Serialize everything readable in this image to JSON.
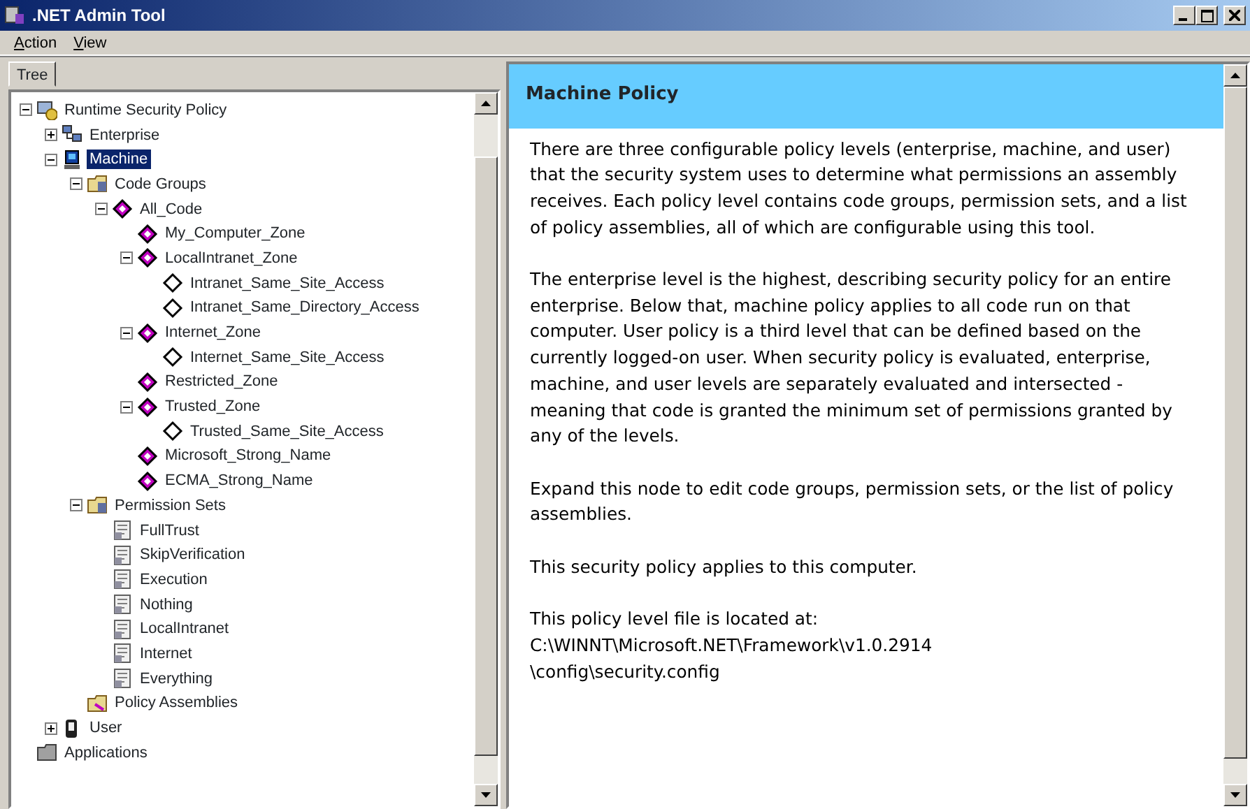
{
  "window": {
    "title": ".NET Admin Tool"
  },
  "menu": [
    "Action",
    "View"
  ],
  "tabs": [
    {
      "label": "Tree",
      "selected": true
    }
  ],
  "tree": [
    {
      "label": "Runtime Security Policy",
      "kind": "policy",
      "expanded": true,
      "selected": false,
      "children": [
        {
          "label": "Enterprise",
          "kind": "enterprise",
          "expanded": false,
          "selected": false
        },
        {
          "label": "Machine",
          "kind": "machine",
          "expanded": true,
          "selected": true,
          "children": [
            {
              "label": "Code Groups",
              "kind": "folder",
              "expanded": true,
              "selected": false,
              "children": [
                {
                  "label": "All_Code",
                  "kind": "group",
                  "expanded": true,
                  "selected": false,
                  "children": [
                    {
                      "label": "My_Computer_Zone",
                      "kind": "group",
                      "selected": false
                    },
                    {
                      "label": "LocalIntranet_Zone",
                      "kind": "group",
                      "expanded": true,
                      "selected": false,
                      "children": [
                        {
                          "label": "Intranet_Same_Site_Access",
                          "kind": "leaf",
                          "selected": false
                        },
                        {
                          "label": "Intranet_Same_Directory_Access",
                          "kind": "leaf",
                          "selected": false
                        }
                      ]
                    },
                    {
                      "label": "Internet_Zone",
                      "kind": "group",
                      "expanded": true,
                      "selected": false,
                      "children": [
                        {
                          "label": "Internet_Same_Site_Access",
                          "kind": "leaf",
                          "selected": false
                        }
                      ]
                    },
                    {
                      "label": "Restricted_Zone",
                      "kind": "group",
                      "selected": false
                    },
                    {
                      "label": "Trusted_Zone",
                      "kind": "group",
                      "expanded": true,
                      "selected": false,
                      "children": [
                        {
                          "label": "Trusted_Same_Site_Access",
                          "kind": "leaf",
                          "selected": false
                        }
                      ]
                    },
                    {
                      "label": "Microsoft_Strong_Name",
                      "kind": "group",
                      "selected": false
                    },
                    {
                      "label": "ECMA_Strong_Name",
                      "kind": "group",
                      "selected": false
                    }
                  ]
                }
              ]
            },
            {
              "label": "Permission Sets",
              "kind": "folder",
              "expanded": true,
              "selected": false,
              "children": [
                {
                  "label": "FullTrust",
                  "kind": "permset",
                  "selected": false
                },
                {
                  "label": "SkipVerification",
                  "kind": "permset",
                  "selected": false
                },
                {
                  "label": "Execution",
                  "kind": "permset",
                  "selected": false
                },
                {
                  "label": "Nothing",
                  "kind": "permset",
                  "selected": false
                },
                {
                  "label": "LocalIntranet",
                  "kind": "permset",
                  "selected": false
                },
                {
                  "label": "Internet",
                  "kind": "permset",
                  "selected": false
                },
                {
                  "label": "Everything",
                  "kind": "permset",
                  "selected": false
                }
              ]
            },
            {
              "label": "Policy Assemblies",
              "kind": "assemblies",
              "selected": false
            }
          ]
        },
        {
          "label": "User",
          "kind": "user",
          "expanded": false,
          "selected": false
        }
      ]
    },
    {
      "label": "Applications",
      "kind": "applications",
      "selected": false
    }
  ],
  "detail": {
    "title": "Machine Policy",
    "paragraphs": [
      "There are three configurable policy levels (enterprise, machine, and user) that the security system uses to determine what permissions an assembly receives. Each policy level contains code groups, permission sets, and a list of policy assemblies, all of which are configurable using this tool.",
      "The enterprise level is the highest, describing security policy for an entire enterprise. Below that, machine policy applies to all code run on that computer. User policy is a third level that can be defined based on the currently logged-on user. When security policy is evaluated, enterprise, machine, and user levels are separately evaluated and intersected - meaning that code is granted the minimum set of permissions granted by any of the levels.",
      "Expand this node to edit code groups, permission sets, or the list of policy assemblies.",
      "This security policy applies to this computer.",
      "This policy level file is located at:\nC:\\WINNT\\Microsoft.NET\\Framework\\v1.0.2914\n\\config\\security.config"
    ]
  }
}
